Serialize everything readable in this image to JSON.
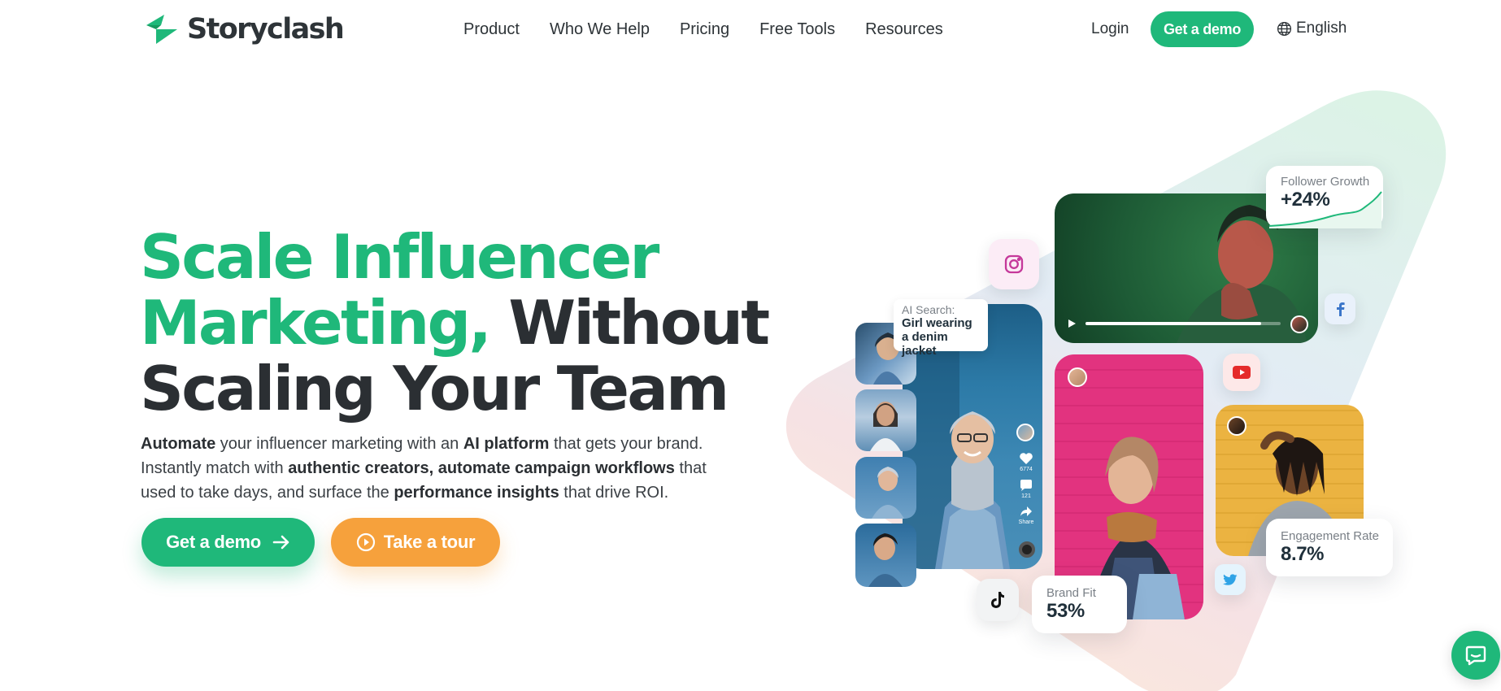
{
  "brand": {
    "name": "Storyclash",
    "accent": "#1fb87a",
    "orange": "#f6a13c",
    "dark": "#2b2f33"
  },
  "nav": {
    "items": [
      {
        "label": "Product"
      },
      {
        "label": "Who We Help"
      },
      {
        "label": "Pricing"
      },
      {
        "label": "Free Tools"
      },
      {
        "label": "Resources"
      }
    ],
    "login": "Login",
    "cta": "Get a demo",
    "language": "English",
    "language_icon": "globe-icon"
  },
  "hero": {
    "headline_green_1": "Scale Influencer",
    "headline_green_2": "Marketing,",
    "headline_dark_1": "Without",
    "headline_dark_2": "Scaling Your Team",
    "lead": {
      "b1": "Automate",
      "t1": " your influencer marketing with an ",
      "b2": "AI platform",
      "t2": " that gets your brand. Instantly match with ",
      "b3": "authentic creators, automate campaign workflows",
      "t3": " that used to take days, and surface the ",
      "b4": "performance insights",
      "t4": " that drive ROI."
    },
    "cta_demo": "Get a demo",
    "cta_tour": "Take a tour"
  },
  "collage": {
    "follower_growth": {
      "label": "Follower Growth",
      "value": "+24%"
    },
    "ai_search": {
      "label": "AI Search:",
      "query": "Girl wearing a denim jacket"
    },
    "engagement_rate": {
      "label": "Engagement Rate",
      "value": "8.7%"
    },
    "brand_fit": {
      "label": "Brand Fit",
      "value": "53%"
    },
    "video_progress": 0.9,
    "like_count": "6774",
    "comment_count": "121",
    "share_label": "Share",
    "social_icons": [
      "instagram-icon",
      "facebook-icon",
      "youtube-icon",
      "twitter-icon",
      "tiktok-icon"
    ]
  },
  "chat_widget_icon": "chat-icon"
}
